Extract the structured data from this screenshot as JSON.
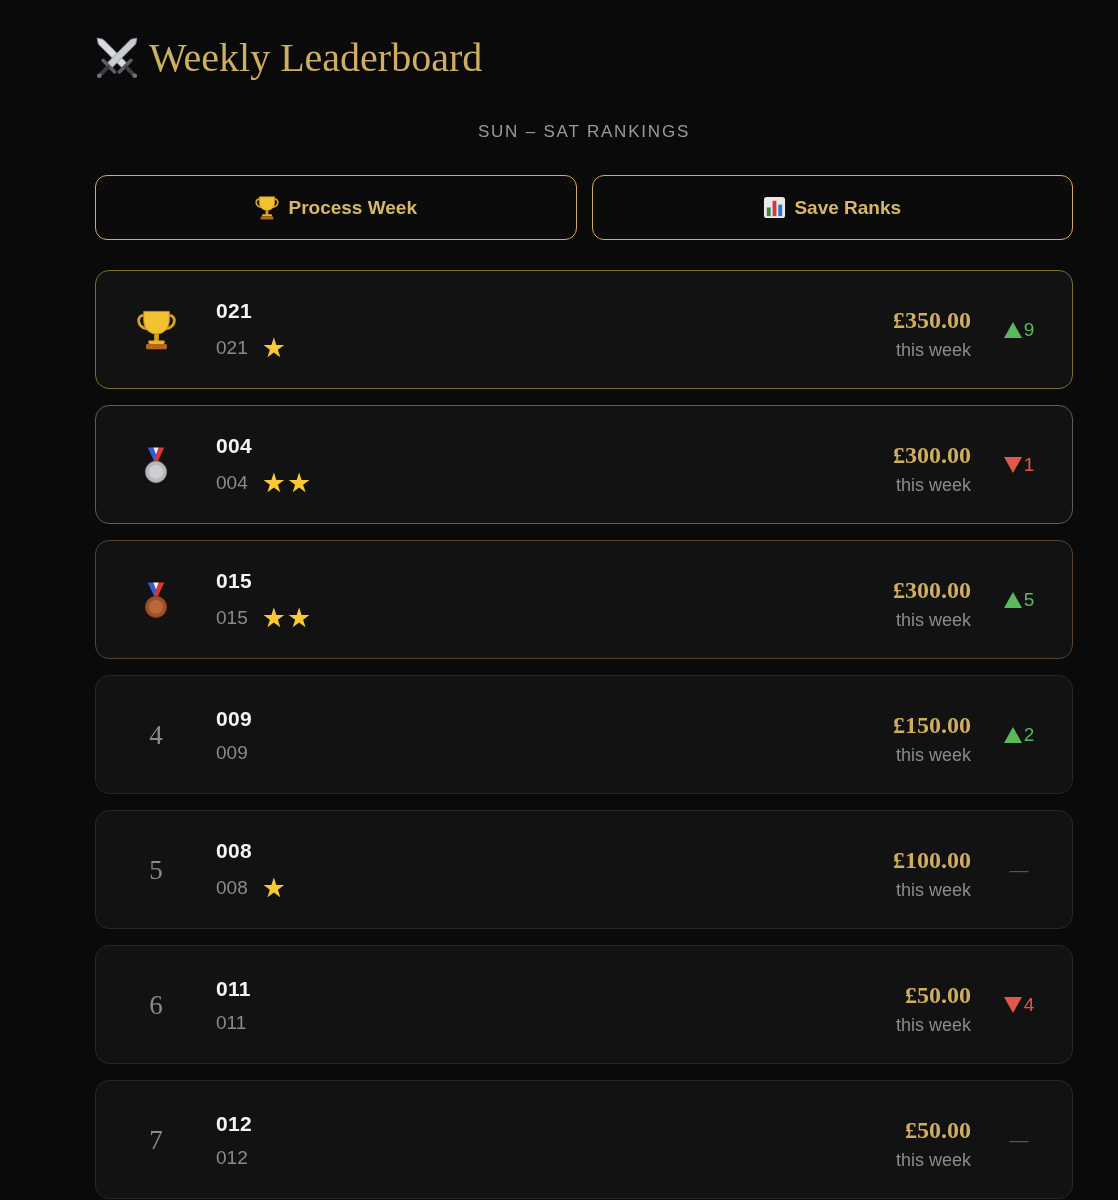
{
  "header": {
    "title": "Weekly Leaderboard",
    "subtitle": "SUN – SAT RANKINGS"
  },
  "actions": [
    {
      "kind": "process",
      "label": "Process Week"
    },
    {
      "kind": "save",
      "label": "Save Ranks"
    }
  ],
  "rows": [
    {
      "kind": "first",
      "name": "021",
      "code": "021",
      "star_badges": "★",
      "amount": "£350.00",
      "period": "this week",
      "change": {
        "kind": "up",
        "value": "9"
      }
    },
    {
      "kind": "second",
      "name": "004",
      "code": "004",
      "star_badges": "★★",
      "amount": "£300.00",
      "period": "this week",
      "change": {
        "kind": "down",
        "value": "1"
      }
    },
    {
      "kind": "third",
      "name": "015",
      "code": "015",
      "star_badges": "★★",
      "amount": "£300.00",
      "period": "this week",
      "change": {
        "kind": "up",
        "value": "5"
      }
    },
    {
      "kind": "standard",
      "rank": "4",
      "name": "009",
      "code": "009",
      "amount": "£150.00",
      "period": "this week",
      "change": {
        "kind": "up",
        "value": "2"
      }
    },
    {
      "kind": "standard",
      "rank": "5",
      "name": "008",
      "code": "008",
      "star_badges": "★",
      "amount": "£100.00",
      "period": "this week",
      "change": {
        "kind": "none",
        "value": "—"
      }
    },
    {
      "kind": "standard",
      "rank": "6",
      "name": "011",
      "code": "011",
      "amount": "£50.00",
      "period": "this week",
      "change": {
        "kind": "down",
        "value": "4"
      }
    },
    {
      "kind": "standard",
      "rank": "7",
      "name": "012",
      "code": "012",
      "amount": "£50.00",
      "period": "this week",
      "change": {
        "kind": "none",
        "value": "—"
      }
    }
  ]
}
